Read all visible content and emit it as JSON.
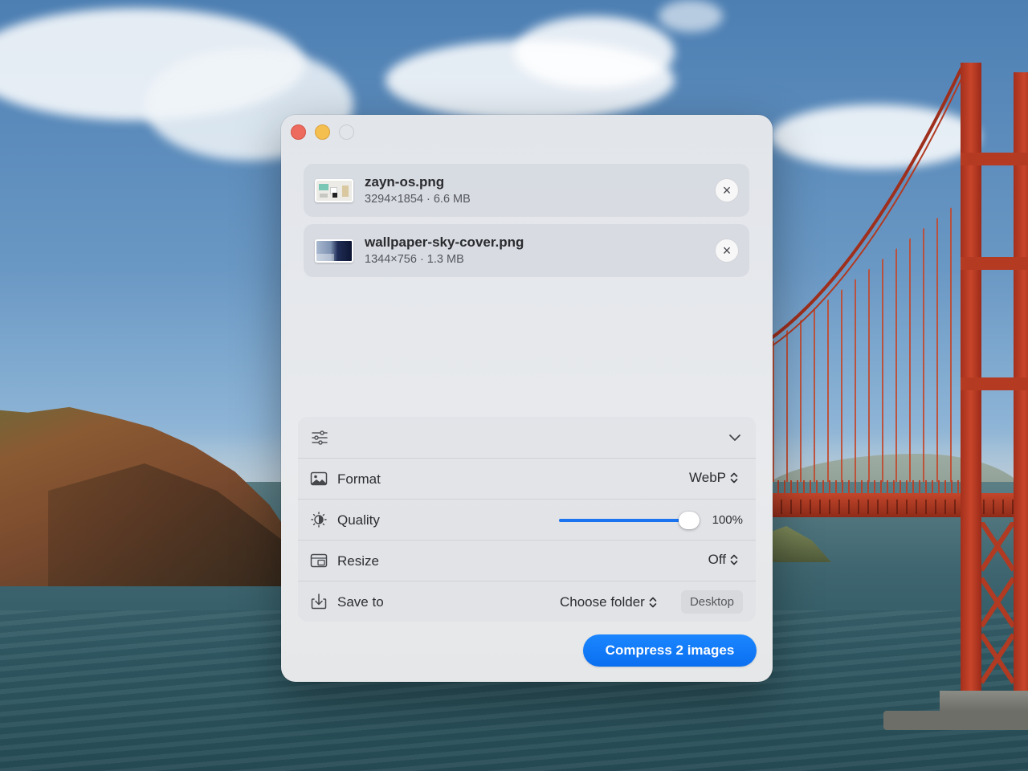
{
  "window": {
    "traffic_lights": [
      "close",
      "minimize",
      "zoom"
    ]
  },
  "files": [
    {
      "name": "zayn-os.png",
      "meta": "3294×1854 · 6.6 MB",
      "thumb": "os-thumbnail"
    },
    {
      "name": "wallpaper-sky-cover.png",
      "meta": "1344×756 · 1.3 MB",
      "thumb": "sky-thumbnail"
    }
  ],
  "remove_icon": "×",
  "settings": {
    "header_icon": "sliders-icon",
    "collapse_icon": "chevron-down-icon",
    "format": {
      "label": "Format",
      "value": "WebP",
      "icon": "image-icon"
    },
    "quality": {
      "label": "Quality",
      "value": "100%",
      "level_percent": 100,
      "icon": "brightness-icon"
    },
    "resize": {
      "label": "Resize",
      "value": "Off",
      "icon": "resize-icon"
    },
    "save_to": {
      "label": "Save to",
      "choose": "Choose folder",
      "destination": "Desktop",
      "icon": "download-icon"
    }
  },
  "actions": {
    "compress_label": "Compress 2 images"
  },
  "colors": {
    "accent": "#1a74f0",
    "close": "#ed6a5e",
    "minimize": "#f5bf4f"
  }
}
